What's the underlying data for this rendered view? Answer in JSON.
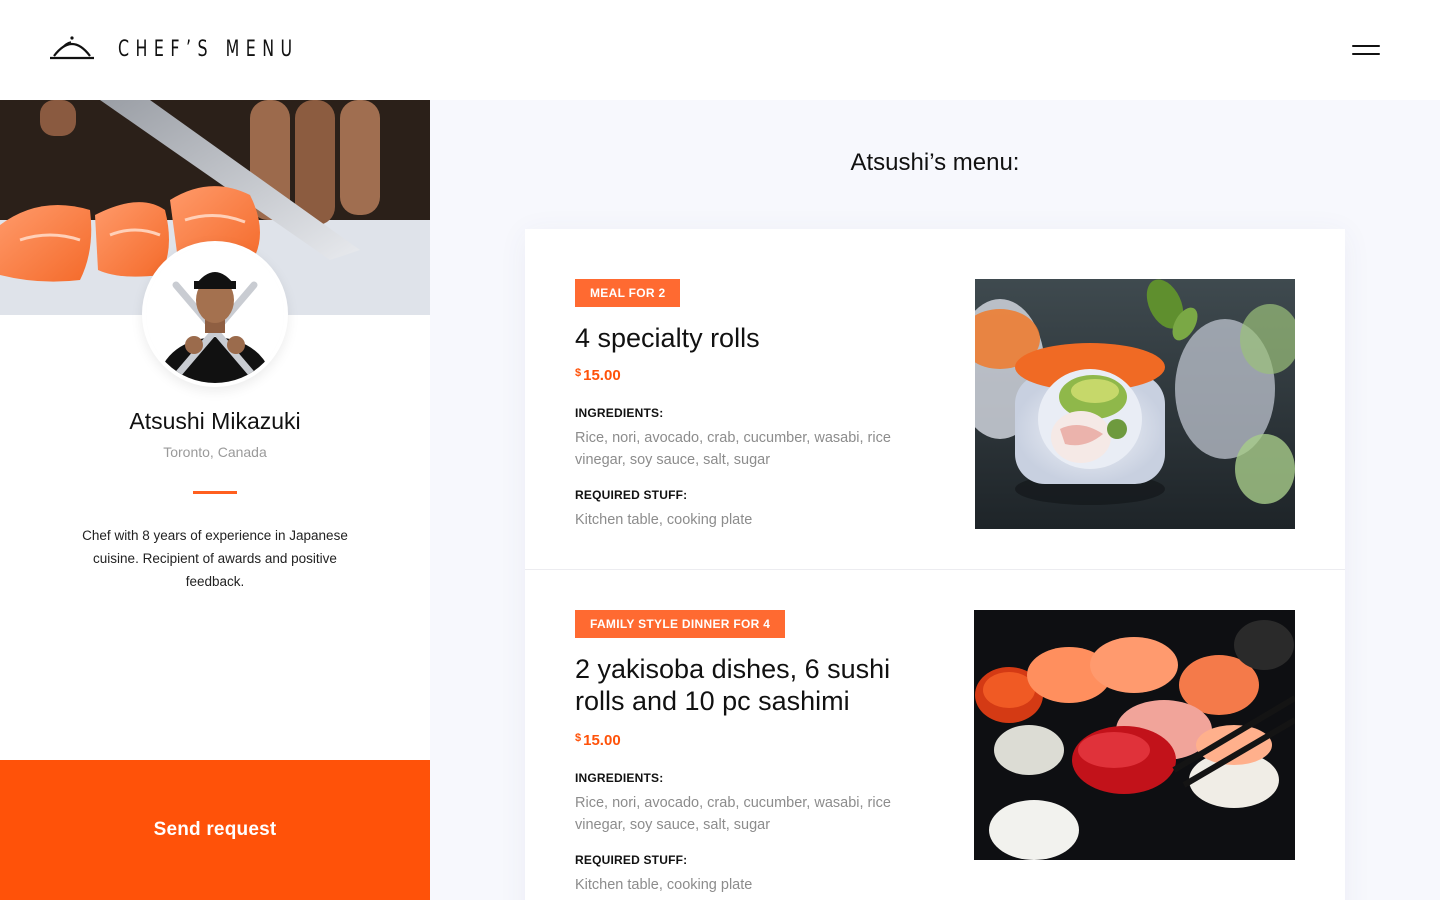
{
  "header": {
    "logo_text": "CHEF’S MENU",
    "logo_icon": "cloche-icon",
    "menu_icon": "hamburger-icon"
  },
  "profile": {
    "name": "Atsushi Mikazuki",
    "location": "Toronto, Canada",
    "bio": "Chef with 8 years of experience in Japanese cuisine. Recipient of awards and positive feedback.",
    "send_button": "Send request"
  },
  "menu": {
    "title": "Atsushi’s menu:",
    "items": [
      {
        "badge": "MEAL FOR 2",
        "title": "4 specialty rolls",
        "currency": "$",
        "price": "15.00",
        "ingredients_label": "INGREDIENTS:",
        "ingredients": "Rice, nori, avocado, crab, cucumber, wasabi, rice vinegar, soy sauce, salt, sugar",
        "required_label": "REQUIRED STUFF:",
        "required": "Kitchen table, cooking plate"
      },
      {
        "badge": "FAMILY STYLE DINNER FOR 4",
        "title": "2 yakisoba dishes, 6 sushi rolls and 10 pc sashimi",
        "currency": "$",
        "price": "15.00",
        "ingredients_label": "INGREDIENTS:",
        "ingredients": "Rice, nori, avocado, crab, cucumber, wasabi, rice vinegar, soy sauce, salt, sugar",
        "required_label": "REQUIRED STUFF:",
        "required": "Kitchen table, cooking plate"
      }
    ]
  },
  "colors": {
    "accent": "#ff5209",
    "badge": "#ff6a31",
    "background": "#f7f8fd"
  }
}
